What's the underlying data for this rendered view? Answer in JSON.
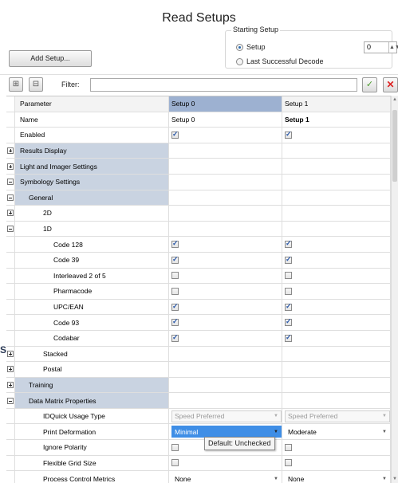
{
  "window": {
    "title": "Read Setups"
  },
  "starting_setup": {
    "label": "Starting Setup",
    "options": [
      {
        "label": "Setup",
        "selected": true
      },
      {
        "label": "Last Successful Decode",
        "selected": false
      }
    ],
    "value": "0"
  },
  "add_setup_label": "Add Setup...",
  "filter": {
    "label": "Filter:",
    "value": ""
  },
  "grid": {
    "columns": [
      "Parameter",
      "Setup 0",
      "Setup 1"
    ],
    "rows": [
      {
        "label": "Name",
        "setup0": "Setup 0",
        "setup1": "Setup 1"
      },
      {
        "label": "Enabled"
      },
      {
        "label": "Results Display"
      },
      {
        "label": "Light and Imager Settings"
      },
      {
        "label": "Symbology Settings"
      },
      {
        "label": "General"
      },
      {
        "label": "2D"
      },
      {
        "label": "1D"
      },
      {
        "label": "Code 128"
      },
      {
        "label": "Code 39"
      },
      {
        "label": "Interleaved 2 of 5"
      },
      {
        "label": "Pharmacode"
      },
      {
        "label": "UPC/EAN"
      },
      {
        "label": "Code 93"
      },
      {
        "label": "Codabar"
      },
      {
        "label": "Stacked"
      },
      {
        "label": "Postal"
      },
      {
        "label": "Training"
      },
      {
        "label": "Data Matrix Properties"
      },
      {
        "label": "IDQuick Usage Type",
        "setup0": "Speed Preferred",
        "setup1": "Speed Preferred"
      },
      {
        "label": "Print Deformation",
        "setup0": "Minimal",
        "setup1": "Moderate"
      },
      {
        "label": "Ignore Polarity"
      },
      {
        "label": "Flexible Grid Size"
      },
      {
        "label": "Process Control Metrics",
        "setup0": "None",
        "setup1": "None"
      }
    ]
  },
  "tooltip": "Default: Unchecked",
  "edge_letter": "S",
  "colors": {
    "selected_header": "#9db1d1",
    "category": "#c9d3e1",
    "selection": "#3f8ee6",
    "ok": "#4a9a2c",
    "cancel": "#d22222"
  }
}
